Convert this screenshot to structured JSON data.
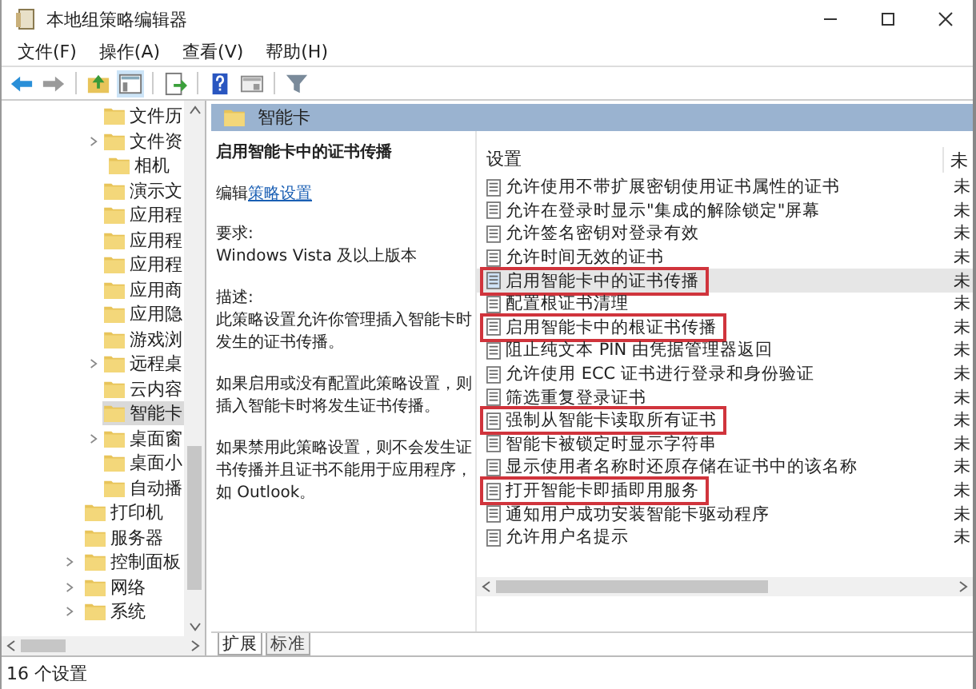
{
  "window": {
    "title": "本地组策略编辑器"
  },
  "menu": [
    "文件(F)",
    "操作(A)",
    "查看(V)",
    "帮助(H)"
  ],
  "tree": {
    "nested_items": [
      {
        "label": "文件历",
        "expandable": false,
        "selected": false
      },
      {
        "label": "文件资",
        "expandable": true,
        "selected": false
      },
      {
        "label": "相机",
        "expandable": false,
        "selected": false
      },
      {
        "label": "演示文",
        "expandable": false,
        "selected": false
      },
      {
        "label": "应用程",
        "expandable": false,
        "selected": false
      },
      {
        "label": "应用程",
        "expandable": false,
        "selected": false
      },
      {
        "label": "应用程",
        "expandable": false,
        "selected": false
      },
      {
        "label": "应用商",
        "expandable": false,
        "selected": false
      },
      {
        "label": "应用隐",
        "expandable": false,
        "selected": false
      },
      {
        "label": "游戏浏",
        "expandable": false,
        "selected": false
      },
      {
        "label": "远程桌",
        "expandable": true,
        "selected": false
      },
      {
        "label": "云内容",
        "expandable": false,
        "selected": false
      },
      {
        "label": "智能卡",
        "expandable": false,
        "selected": true
      },
      {
        "label": "桌面窗",
        "expandable": true,
        "selected": false
      },
      {
        "label": "桌面小",
        "expandable": false,
        "selected": false
      },
      {
        "label": "自动播",
        "expandable": false,
        "selected": false
      }
    ],
    "items": [
      {
        "label": "打印机",
        "expandable": false,
        "selected": false
      },
      {
        "label": "服务器",
        "expandable": false,
        "selected": false
      },
      {
        "label": "控制面板",
        "expandable": true,
        "selected": false
      },
      {
        "label": "网络",
        "expandable": true,
        "selected": false
      },
      {
        "label": "系统",
        "expandable": true,
        "selected": false
      }
    ]
  },
  "header": {
    "title": "智能卡"
  },
  "description": {
    "title": "启用智能卡中的证书传播",
    "edit_prefix": "编辑",
    "edit_link": "策略设置",
    "paragraphs": [
      "要求:\nWindows Vista 及以上版本",
      "描述:\n此策略设置允许你管理插入智能卡时发生的证书传播。",
      "如果启用或没有配置此策略设置，则插入智能卡时将发生证书传播。",
      "如果禁用此策略设置，则不会发生证书传播并且证书不能用于应用程序，如 Outlook。"
    ]
  },
  "table": {
    "columns": [
      "设置",
      "未"
    ],
    "rows": [
      {
        "name": "允许使用不带扩展密钥使用证书属性的证书",
        "state": "未",
        "selected": false,
        "marked": false
      },
      {
        "name": "允许在登录时显示\"集成的解除锁定\"屏幕",
        "state": "未",
        "selected": false,
        "marked": false
      },
      {
        "name": "允许签名密钥对登录有效",
        "state": "未",
        "selected": false,
        "marked": false
      },
      {
        "name": "允许时间无效的证书",
        "state": "未",
        "selected": false,
        "marked": false
      },
      {
        "name": "启用智能卡中的证书传播",
        "state": "未",
        "selected": true,
        "marked": true
      },
      {
        "name": "配置根证书清理",
        "state": "未",
        "selected": false,
        "marked": false
      },
      {
        "name": "启用智能卡中的根证书传播",
        "state": "未",
        "selected": false,
        "marked": true
      },
      {
        "name": "阻止纯文本 PIN 由凭据管理器返回",
        "state": "未",
        "selected": false,
        "marked": false
      },
      {
        "name": "允许使用 ECC 证书进行登录和身份验证",
        "state": "未",
        "selected": false,
        "marked": false
      },
      {
        "name": "筛选重复登录证书",
        "state": "未",
        "selected": false,
        "marked": false
      },
      {
        "name": "强制从智能卡读取所有证书",
        "state": "未",
        "selected": false,
        "marked": true
      },
      {
        "name": "智能卡被锁定时显示字符串",
        "state": "未",
        "selected": false,
        "marked": false
      },
      {
        "name": "显示使用者名称时还原存储在证书中的该名称",
        "state": "未",
        "selected": false,
        "marked": false
      },
      {
        "name": "打开智能卡即插即用服务",
        "state": "未",
        "selected": false,
        "marked": true
      },
      {
        "name": "通知用户成功安装智能卡驱动程序",
        "state": "未",
        "selected": false,
        "marked": false
      },
      {
        "name": "允许用户名提示",
        "state": "未",
        "selected": false,
        "marked": false
      }
    ]
  },
  "tabs": [
    {
      "label": "扩展",
      "selected": true
    },
    {
      "label": "标准",
      "selected": false
    }
  ],
  "status_bar": "16 个设置"
}
